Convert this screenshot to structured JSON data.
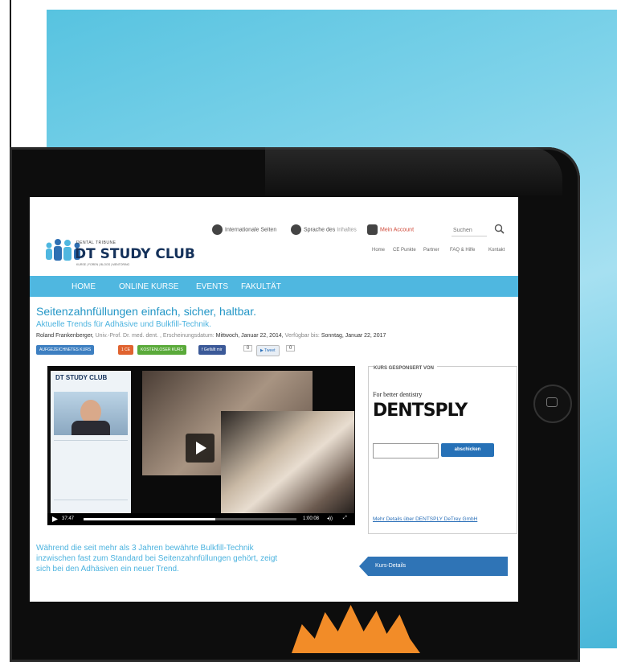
{
  "site": {
    "logo_small": "DENTAL TRIBUNE",
    "logo_main": "DT STUDY CLUB",
    "logo_tagline": "KURSE | FOREN | BLOGS | MENTORING"
  },
  "topbar": {
    "international": "Internationale Seiten",
    "language_prefix": "Sprache des",
    "language_suffix": "Inhaltes",
    "account": "Mein Account",
    "search_placeholder": "Suchen"
  },
  "subnav": [
    "Home",
    "CE Punkte",
    "Partner",
    "FAQ & Hilfe",
    "Kontakt"
  ],
  "nav": [
    "HOME",
    "ONLINE KURSE",
    "EVENTS",
    "FAKULTÄT"
  ],
  "course": {
    "title": "Seitenzahnfüllungen einfach, sicher, haltbar.",
    "subtitle": "Aktuelle Trends für Adhäsive und Bulkfill-Technik.",
    "author": "Roland Frankenberger,",
    "author_title": "Univ.-Prof. Dr. med. dent. ,",
    "published_label": "Erscheinungsdatum:",
    "published": "Mittwoch, Januar 22, 2014,",
    "available_label": "Verfügbar bis:",
    "available": "Sonntag, Januar 22, 2017"
  },
  "badges": {
    "recorded": "AUFGEZEICHNETES KURS",
    "ce": "1 CE",
    "free": "KOSTENLOSER KURS",
    "like": "Gefällt mir",
    "like_count": "0",
    "tweet": "Tweet",
    "tweet_count": "0"
  },
  "player": {
    "thumb_logo": "DT STUDY CLUB",
    "elapsed": "37:47",
    "remaining": "1:00:08",
    "progress": 0.62
  },
  "sponsor": {
    "heading": "KURS GESPONSERT VON",
    "tagline": "For better dentistry",
    "brand": "DENTSPLY",
    "submit": "abschicken",
    "details_link": "Mehr Details über DENTSPLY DeTrey GmbH"
  },
  "description": "Während die seit mehr als 3 Jahren bewährte Bulkfill-Technik inzwischen fast zum Standard bei Seitenzahnfüllungen gehört, zeigt sich bei den Adhäsiven ein neuer Trend.",
  "kurs_details": "Kurs-Details",
  "colors": {
    "accent": "#4fb7e0",
    "title": "#2396c6",
    "badge_recorded": "#3d7fc1",
    "badge_ce": "#e0632f",
    "badge_free": "#5aaa3a",
    "facebook": "#3b5998"
  }
}
